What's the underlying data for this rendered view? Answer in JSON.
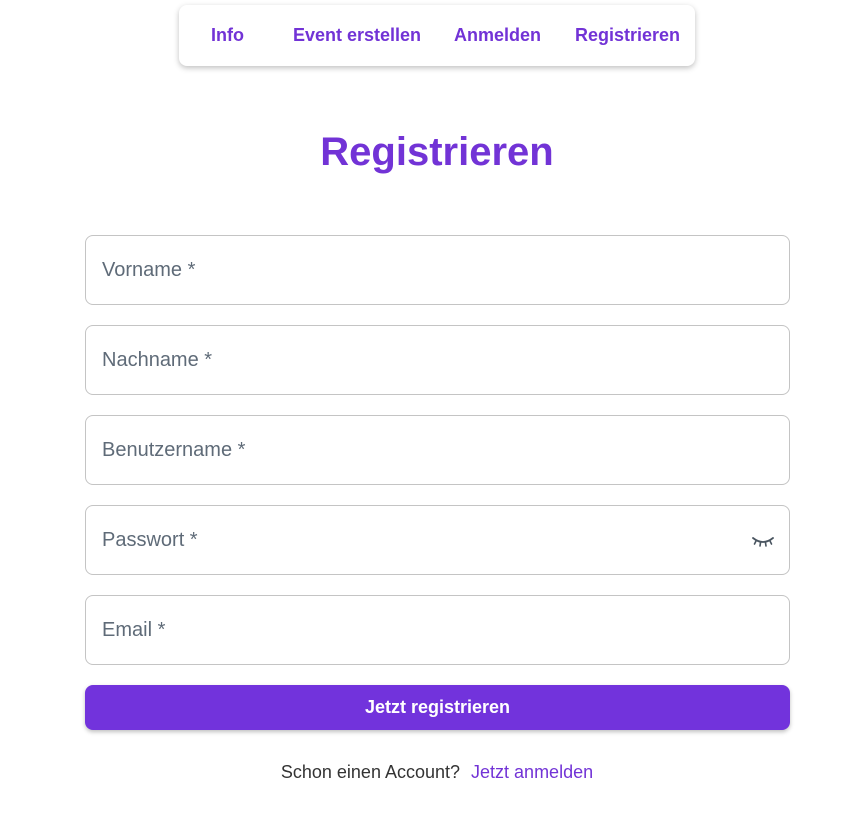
{
  "nav": {
    "items": [
      {
        "label": "Info"
      },
      {
        "label": "Event erstellen"
      },
      {
        "label": "Anmelden"
      },
      {
        "label": "Registrieren"
      }
    ]
  },
  "page": {
    "title": "Registrieren"
  },
  "form": {
    "first_name": {
      "placeholder": "Vorname *",
      "value": ""
    },
    "last_name": {
      "placeholder": "Nachname *",
      "value": ""
    },
    "username": {
      "placeholder": "Benutzername *",
      "value": ""
    },
    "password": {
      "placeholder": "Passwort *",
      "value": "",
      "toggle_icon": "eye-closed-icon"
    },
    "email": {
      "placeholder": "Email *",
      "value": ""
    },
    "submit_label": "Jetzt registrieren"
  },
  "footer": {
    "prompt": "Schon einen Account?",
    "link_label": "Jetzt anmelden"
  },
  "colors": {
    "accent": "#7233d6",
    "button": "#7233dc",
    "placeholder": "#5f6b78",
    "border": "#c4c4c4"
  }
}
